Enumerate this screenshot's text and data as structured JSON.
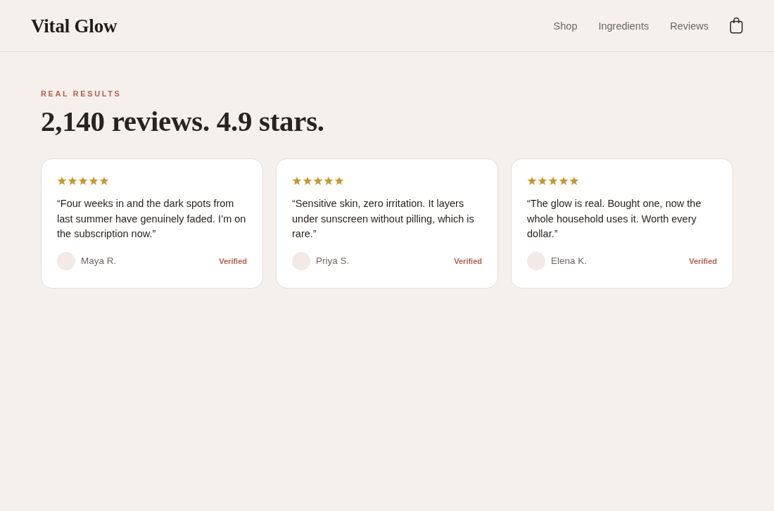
{
  "header": {
    "logo": "Vital Glow",
    "nav": [
      "Shop",
      "Ingredients",
      "Reviews"
    ]
  },
  "section": {
    "eyebrow": "REAL RESULTS",
    "heading": "2,140 reviews. 4.9 stars."
  },
  "reviews": [
    {
      "stars": 5,
      "quote": "“Four weeks in and the dark spots from last summer have genuinely faded. I’m on the subscription now.”",
      "author": "Maya R.",
      "badge": "Verified"
    },
    {
      "stars": 5,
      "quote": "“Sensitive skin, zero irritation. It layers under sunscreen without pilling, which is rare.”",
      "author": "Priya S.",
      "badge": "Verified"
    },
    {
      "stars": 5,
      "quote": "“The glow is real. Bought one, now the whole household uses it. Worth every dollar.”",
      "author": "Elena K.",
      "badge": "Verified"
    }
  ]
}
